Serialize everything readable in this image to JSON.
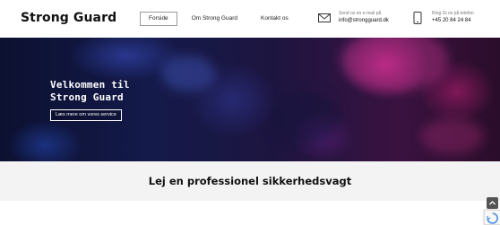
{
  "header": {
    "logo": "Strong Guard",
    "nav": [
      {
        "label": "Forside",
        "active": true
      },
      {
        "label": "Om Strong Guard",
        "active": false
      },
      {
        "label": "Kontakt os",
        "active": false
      }
    ],
    "email": {
      "label": "Send os en e-mail på",
      "value": "info@strongguard.dk",
      "icon": "envelope-icon"
    },
    "phone": {
      "label": "Ring Gi os på telefon",
      "value": "+45 20 84 24 84",
      "icon": "smartphone-icon"
    }
  },
  "hero": {
    "title_line1": "Velkommen til",
    "title_line2": "Strong Guard",
    "button_label": "Læs mere om vores service"
  },
  "section": {
    "title": "Lej en professionel sikkerhedsvagt"
  },
  "widgets": {
    "scroll_top_icon": "chevron-up-icon",
    "recaptcha_icon": "recaptcha-icon"
  }
}
